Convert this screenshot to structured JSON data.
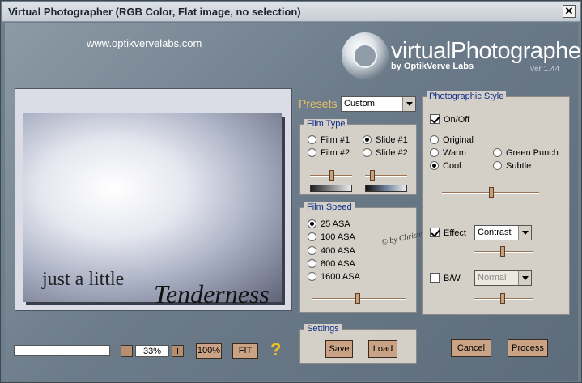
{
  "window": {
    "title": "Virtual Photographer (RGB Color, Flat image, no selection)",
    "close_glyph": "✕"
  },
  "brand": {
    "url": "www.optikvervelabs.com",
    "name": "virtualPhotographer",
    "byline": "by OptikVerve Labs",
    "version": "ver 1.44"
  },
  "preview": {
    "caption_line1": "just a little",
    "caption_line2": "Tenderness"
  },
  "presets": {
    "label": "Presets",
    "selected": "Custom"
  },
  "film_type": {
    "title": "Film Type",
    "options": [
      "Film #1",
      "Slide #1",
      "Film #2",
      "Slide #2"
    ],
    "selected": "Slide #1"
  },
  "film_speed": {
    "title": "Film Speed",
    "options": [
      "25 ASA",
      "100 ASA",
      "400 ASA",
      "800 ASA",
      "1600 ASA"
    ],
    "selected": "25 ASA"
  },
  "signature": "© by Christa",
  "photographic_style": {
    "title": "Photographic Style",
    "onoff_label": "On/Off",
    "onoff_checked": true,
    "styles": [
      "Original",
      "Green Punch",
      "Warm",
      "Subtle",
      "Cool"
    ],
    "selected_style": "Cool",
    "effect_label": "Effect",
    "effect_checked": true,
    "effect_selected": "Contrast",
    "bw_label": "B/W",
    "bw_checked": false,
    "bw_selected": "Normal"
  },
  "settings": {
    "title": "Settings",
    "save_label": "Save",
    "load_label": "Load"
  },
  "zoom": {
    "value": "33%",
    "btn_100": "100%",
    "btn_fit": "FIT",
    "help_glyph": "?"
  },
  "actions": {
    "cancel_label": "Cancel",
    "process_label": "Process"
  },
  "colors": {
    "accent_text": "#e8c060",
    "group_title": "#0d2d8a",
    "button": "#caa386"
  }
}
